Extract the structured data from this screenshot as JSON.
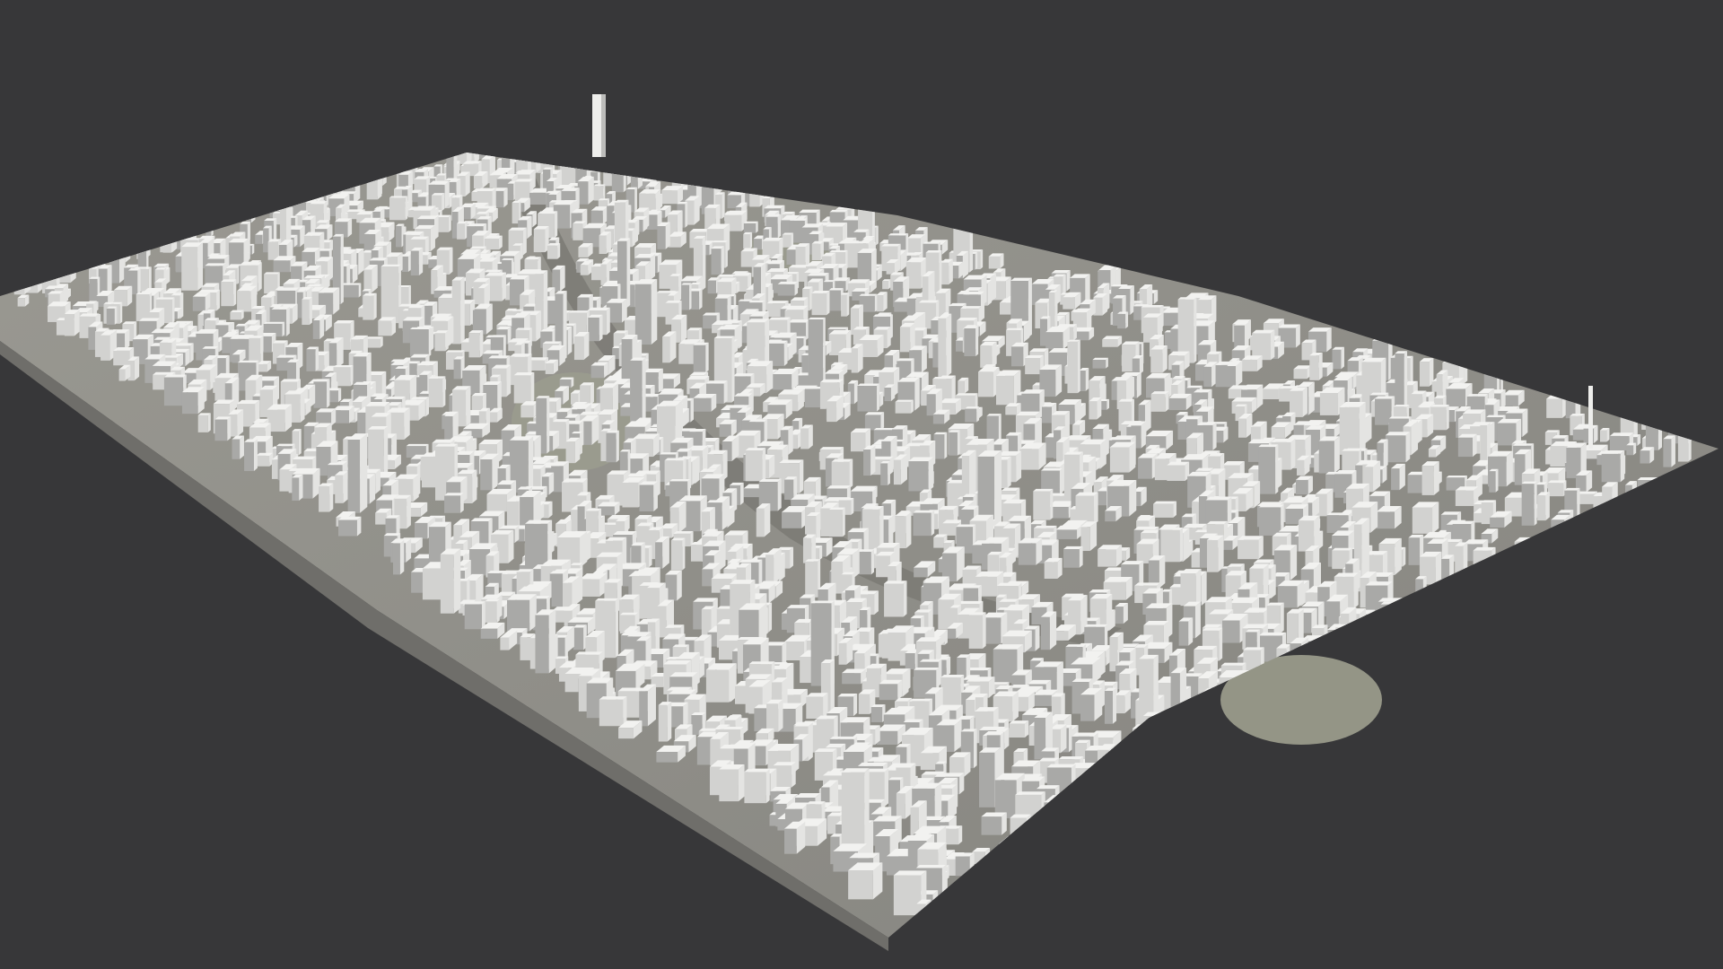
{
  "viewport": {
    "background": "#373739",
    "description_kind": "3d-city-block-model-render"
  },
  "scene": {
    "ground_color": "#8f8e88",
    "building_light": "#f2f2f0",
    "building_mid": "#d2d2d0",
    "building_shadow": "#a9a9a7",
    "river_color": "#7a7a74",
    "park_color": "#9a9b8e"
  }
}
